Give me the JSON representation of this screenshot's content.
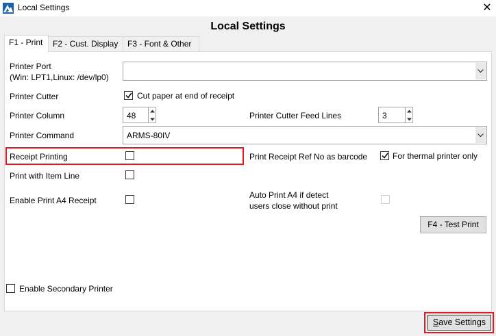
{
  "window": {
    "title": "Local Settings",
    "close_glyph": "✕"
  },
  "heading": "Local Settings",
  "tabs": [
    {
      "label": "F1 - Print",
      "active": true
    },
    {
      "label": "F2 - Cust. Display",
      "active": false
    },
    {
      "label": "F3 - Font & Other",
      "active": false
    }
  ],
  "form": {
    "printer_port": {
      "label_line1": "Printer Port",
      "label_line2": "(Win: LPT1,Linux: /dev/lp0)",
      "value": ""
    },
    "printer_cutter": {
      "label": "Printer Cutter",
      "checkbox_label": "Cut paper at end of receipt",
      "checked": true
    },
    "printer_column": {
      "label": "Printer Column",
      "value": "48"
    },
    "cutter_feed_lines": {
      "label": "Printer Cutter Feed Lines",
      "value": "3"
    },
    "printer_command": {
      "label": "Printer Command",
      "value": "ARMS-80IV"
    },
    "receipt_printing": {
      "label": "Receipt Printing",
      "checked": false
    },
    "receipt_ref_barcode": {
      "label": "Print Receipt Ref No as barcode",
      "checkbox_label": "For thermal printer only",
      "checked": true
    },
    "print_item_line": {
      "label": "Print with Item Line",
      "checked": false
    },
    "enable_a4": {
      "label": "Enable Print A4 Receipt",
      "checked": false
    },
    "auto_print_a4": {
      "label_line1": "Auto Print A4 if detect",
      "label_line2": "users close without print",
      "checked": false
    },
    "test_print_label": "F4 - Test Print",
    "secondary_printer": {
      "label": "Enable Secondary Printer",
      "checked": false
    }
  },
  "save_label": "Save Settings",
  "save_label_underline": "S",
  "save_label_rest": "ave Settings",
  "highlight_color": "#e01b24",
  "icons": {
    "app": "app-logo-icon",
    "check": "checkmark-icon",
    "dropdown": "chevron-down-icon"
  }
}
